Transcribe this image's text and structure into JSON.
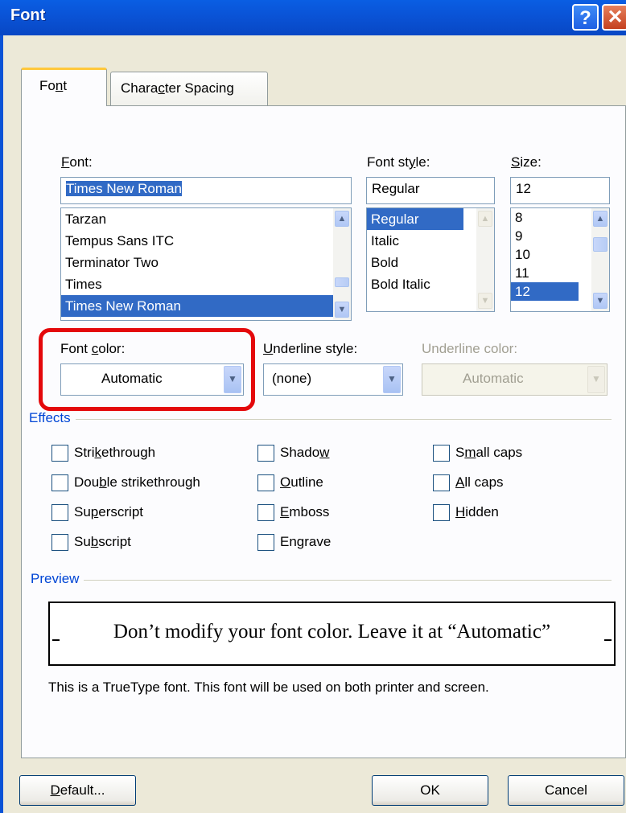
{
  "window": {
    "title": "Font",
    "help_glyph": "?",
    "close_glyph": "✕"
  },
  "tabs": [
    {
      "label_pre": "Fo",
      "label_u": "n",
      "label_post": "t"
    },
    {
      "label_pre": "Chara",
      "label_u": "c",
      "label_post": "ter Spacing"
    }
  ],
  "font": {
    "label_u": "F",
    "label_post": "ont:",
    "value": "Times New Roman",
    "items": [
      "Tarzan",
      "Tempus Sans ITC",
      "Terminator Two",
      "Times",
      "Times New Roman"
    ]
  },
  "style": {
    "label_pre": "Font st",
    "label_u": "y",
    "label_post": "le:",
    "value": "Regular",
    "items": [
      "Regular",
      "Italic",
      "Bold",
      "Bold Italic"
    ]
  },
  "size": {
    "label_u": "S",
    "label_post": "ize:",
    "value": "12",
    "items": [
      "8",
      "9",
      "10",
      "11",
      "12"
    ]
  },
  "font_color": {
    "label_pre": "Font ",
    "label_u": "c",
    "label_post": "olor:",
    "value": "Automatic"
  },
  "underline_style": {
    "label_u": "U",
    "label_post": "nderline style:",
    "value": "(none)"
  },
  "underline_color": {
    "label": "Underline color:",
    "value": "Automatic"
  },
  "effects": {
    "label": "Effects",
    "items": [
      {
        "pre": "Stri",
        "u": "k",
        "post": "ethrough"
      },
      {
        "pre": "Dou",
        "u": "b",
        "post": "le strikethrough"
      },
      {
        "pre": "Su",
        "u": "p",
        "post": "erscript"
      },
      {
        "pre": "Su",
        "u": "b",
        "post": "script"
      },
      {
        "pre": "Shado",
        "u": "w",
        "post": ""
      },
      {
        "pre": "",
        "u": "O",
        "post": "utline"
      },
      {
        "pre": "",
        "u": "E",
        "post": "mboss"
      },
      {
        "pre": "En",
        "u": "g",
        "post": "rave"
      },
      {
        "pre": "S",
        "u": "m",
        "post": "all caps"
      },
      {
        "pre": "",
        "u": "A",
        "post": "ll caps"
      },
      {
        "pre": "",
        "u": "H",
        "post": "idden"
      }
    ]
  },
  "preview": {
    "label": "Preview",
    "text": "Don’t modify your font color.  Leave it at “Automatic”",
    "note": "This is a TrueType font. This font will be used on both printer and screen."
  },
  "buttons": {
    "default_u": "D",
    "default_post": "efault...",
    "ok": "OK",
    "cancel": "Cancel"
  },
  "colors": {
    "titlebar": "#0a53d6",
    "selection": "#316ac5",
    "highlight": "#e4090b",
    "group_label": "#0046d5"
  }
}
